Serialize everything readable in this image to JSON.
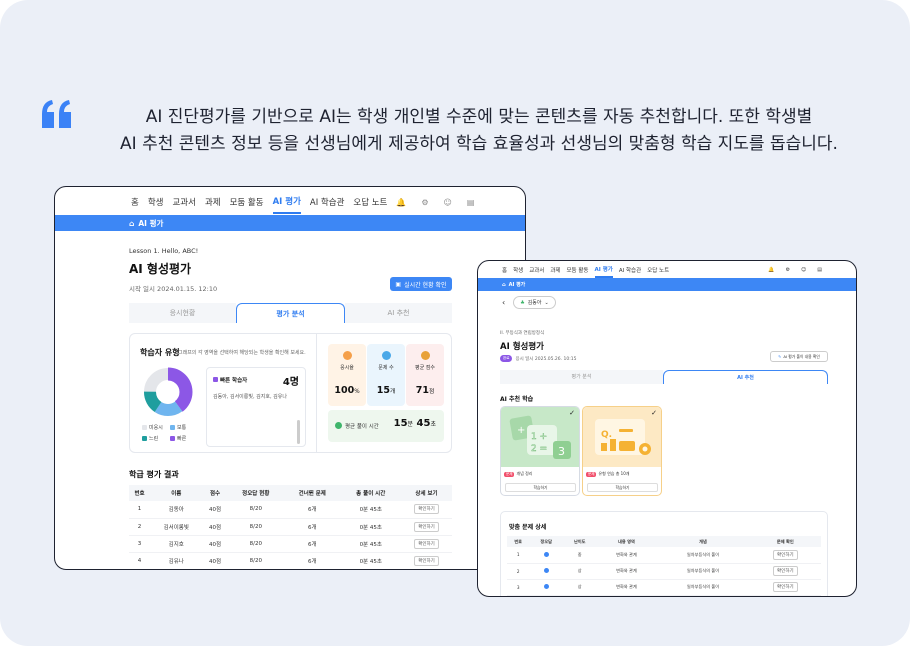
{
  "intro": {
    "line1": "AI 진단평가를 기반으로 AI는 학생 개인별 수준에 맞는 콘텐츠를 자동 추천합니다. 또한 학생별",
    "line2": "AI 추천 콘텐츠 정보 등을 선생님에게 제공하여 학습 효율성과 선생님의 맞춤형 학습 지도를 돕습니다."
  },
  "colors": {
    "brand_blue": "#3d87f5",
    "bg": "#ebeff7",
    "quote_blue": "#3b82f6"
  },
  "nav": {
    "items": [
      "홈",
      "학생",
      "교과서",
      "과제",
      "모둠 활동",
      "AI 평가",
      "AI 학습관",
      "오답 노트"
    ],
    "active": "AI 평가",
    "icons": [
      "bell-icon",
      "gear-icon",
      "chat-icon",
      "document-icon"
    ]
  },
  "window1": {
    "breadcrumb": "AI 평가",
    "lesson": "Lesson 1. Hello, ABC!",
    "title": "AI 형성평가",
    "date": "시작 일시 2024.01.15. 12:10",
    "realtime_button": "실시간 현황 확인",
    "tabs": [
      "응시현황",
      "평가 분석",
      "AI 추천"
    ],
    "active_tab": "평가 분석",
    "learner_type": {
      "title": "학습자 유형",
      "desc": "그래프의 각 영역을 선택하여 해당되는 학생을 확인해 보세요.",
      "legend": [
        {
          "label": "미응시",
          "color": "#e4e6ea"
        },
        {
          "label": "보통",
          "color": "#6fb5ef"
        },
        {
          "label": "느린",
          "color": "#1f9e9e"
        },
        {
          "label": "빠른",
          "color": "#8c57e6"
        }
      ],
      "fast_label": "빠른 학습자",
      "fast_count": "4명",
      "fast_names": "김동아, 김서이롱빛, 김지호, 김유나"
    },
    "stats": [
      {
        "label": "응시율",
        "value": "100",
        "unit": "%",
        "bg": "#fff3e6",
        "icon": "#f5a04a"
      },
      {
        "label": "문제 수",
        "value": "15",
        "unit": "개",
        "bg": "#eaf5fd",
        "icon": "#4aa8e8"
      },
      {
        "label": "평균 점수",
        "value": "71",
        "unit": "점",
        "bg": "#fdeeee",
        "icon": "#e8a23a"
      }
    ],
    "avg_time": {
      "label": "평균 풀이 시간",
      "min": "15",
      "min_unit": "분",
      "sec": "45",
      "sec_unit": "초"
    },
    "results_title": "학급 평가 결과",
    "table_headers": [
      "번호",
      "이름",
      "점수",
      "정오답 현황",
      "건너뛴 문제",
      "총 풀이 시간",
      "상세 보기"
    ],
    "rows": [
      {
        "no": "1",
        "name": "김동아",
        "score": "40점",
        "ox": "8/20",
        "skip": "6개",
        "time": "0분 45초",
        "btn": "확인하기"
      },
      {
        "no": "2",
        "name": "김서이롱빛",
        "score": "40점",
        "ox": "8/20",
        "skip": "6개",
        "time": "0분 45초",
        "btn": "확인하기"
      },
      {
        "no": "3",
        "name": "김지호",
        "score": "40점",
        "ox": "8/20",
        "skip": "6개",
        "time": "0분 45초",
        "btn": "확인하기"
      },
      {
        "no": "4",
        "name": "김유나",
        "score": "40점",
        "ox": "8/20",
        "skip": "6개",
        "time": "0분 45초",
        "btn": "확인하기"
      }
    ]
  },
  "window2": {
    "breadcrumb": "AI 평가",
    "student_select": "김동아",
    "crumb": "II. 무등식과 연립방정식",
    "title": "AI 형성평가",
    "badge": "완료",
    "date": "응시 일시 2025.05.26. 10:15",
    "feedback_button": "AI 평가 풀이 내용 확인",
    "tabs": [
      "평가 분석",
      "AI 추천"
    ],
    "active_tab": "AI 추천",
    "rec_title": "AI 추천 학습",
    "cards": [
      {
        "tag": "문제",
        "text": "개념 정리",
        "button": "학습하기",
        "color": "#c7e8c8"
      },
      {
        "tag": "문제",
        "text": "유형 연습 총 10개",
        "button": "학습하기",
        "color": "#fde9c4"
      }
    ],
    "detail_title": "맞춤 문제 상세",
    "table_headers": [
      "번호",
      "정오답",
      "난이도",
      "내용 영역",
      "개념",
      "문제 확인"
    ],
    "rows": [
      {
        "no": "1",
        "level": "중",
        "area": "변화와 관계",
        "concept": "일차부등식의 풀이",
        "btn": "확인하기"
      },
      {
        "no": "2",
        "level": "상",
        "area": "변화와 관계",
        "concept": "일차부등식의 풀이",
        "btn": "확인하기"
      },
      {
        "no": "3",
        "level": "상",
        "area": "변화와 관계",
        "concept": "일차부등식의 풀이",
        "btn": "확인하기"
      }
    ]
  }
}
